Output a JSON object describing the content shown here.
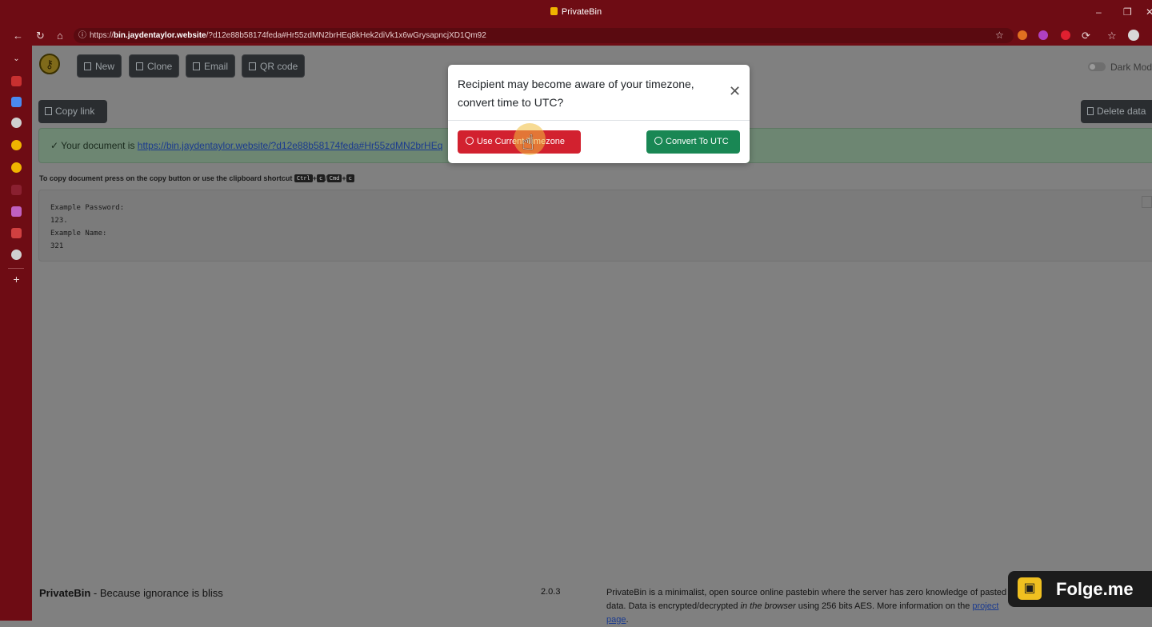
{
  "browser": {
    "window_title": "PrivateBin",
    "url_prefix": "https://",
    "url_host": "bin.jaydentaylor.website",
    "url_rest": "/?d12e88b58174feda#Hr55zdMN2brHEq8kHek2diVk1x6wGrysapncjXD1Qm92"
  },
  "toolbar": {
    "new_label": "New",
    "clone_label": "Clone",
    "email_label": "Email",
    "qr_label": "QR code",
    "dark_mode_label": "Dark Mod"
  },
  "actions": {
    "copy_link_label": "Copy link",
    "delete_label": "Delete data"
  },
  "alert": {
    "prefix": "✓ Your document is ",
    "link": "https://bin.jaydentaylor.website/?d12e88b58174feda#Hr55zdMN2brHEq"
  },
  "hint": {
    "text": "To copy document press on the copy button or use the clipboard shortcut",
    "key_ctrl": "Ctrl",
    "key_c": "c",
    "key_cmd": "Cmd",
    "plus": "+",
    "slash": "/"
  },
  "document": {
    "content": "Example Password:\n123.\nExample Name:\n321"
  },
  "modal": {
    "title": "Recipient may become aware of your timezone, convert time to UTC?",
    "close_symbol": "✕",
    "current_tz_label": "Use Current Timezone",
    "utc_label": "Convert To UTC"
  },
  "footer": {
    "brand": "PrivateBin",
    "tagline": " - Because ignorance is bliss",
    "version": "2.0.3",
    "info_1": "PrivateBin is a minimalist, open source online pastebin where the server has zero knowledge of pasted data. Data is encrypted/decrypted ",
    "info_em": "in the browser",
    "info_2": " using 256 bits AES. More information on the ",
    "info_link": "project page",
    "info_end": "."
  },
  "watermark": {
    "text": "Folge.me"
  }
}
